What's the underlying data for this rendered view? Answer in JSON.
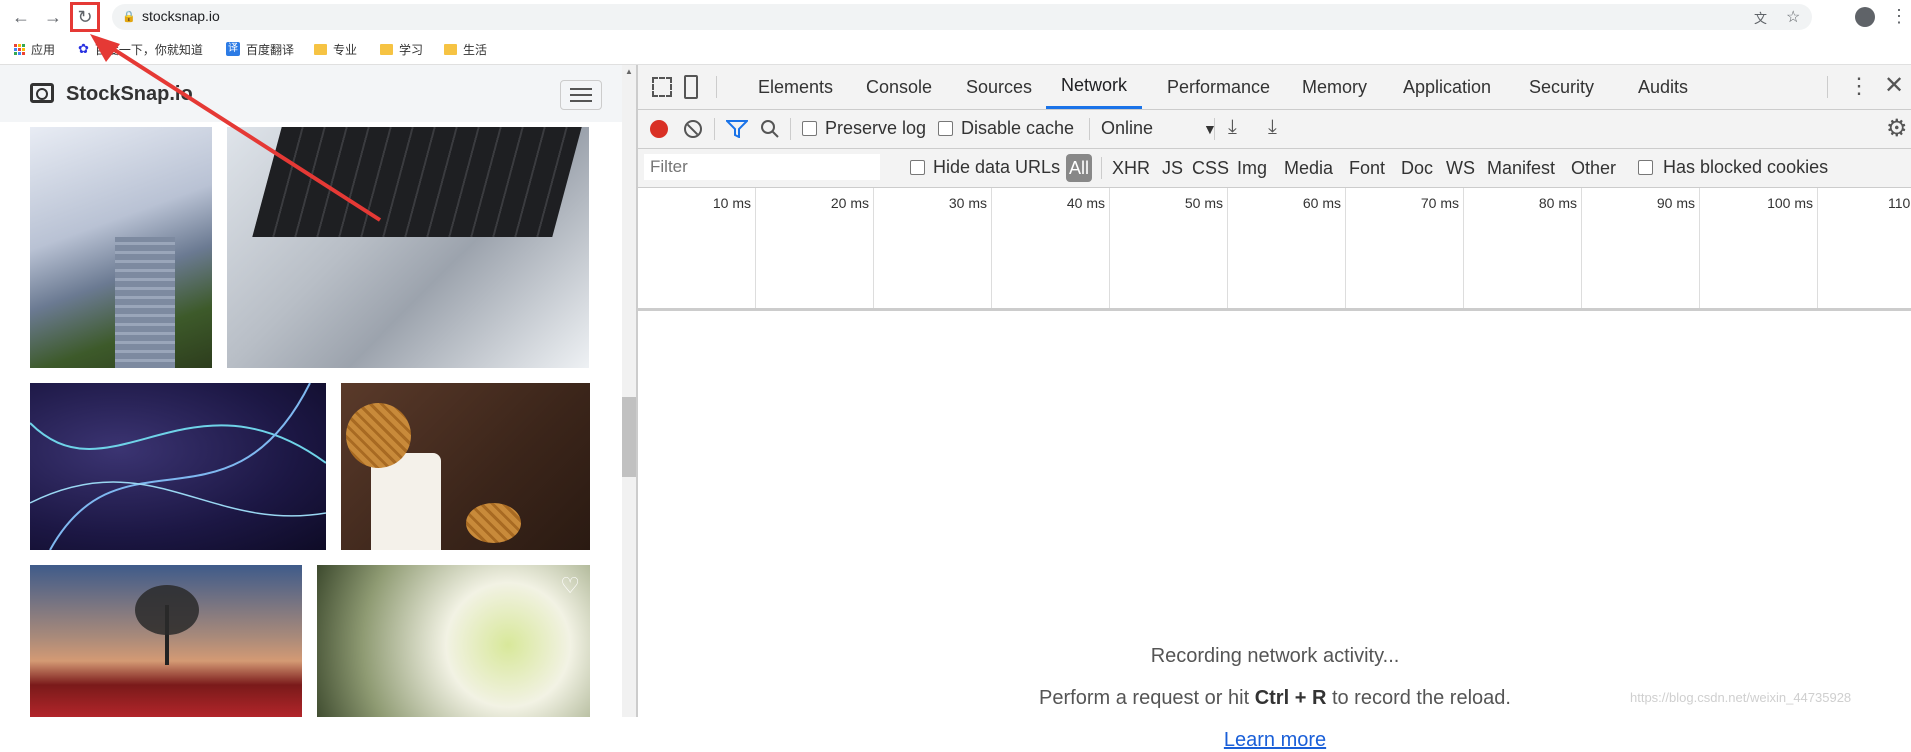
{
  "browser": {
    "url": "stocksnap.io",
    "bookmarks": [
      {
        "label": "应用",
        "icon": "apps-grid-icon"
      },
      {
        "label": "百度一下，你就知道",
        "icon": "baidu-paw-icon"
      },
      {
        "label": "百度翻译",
        "icon": "baidu-translate-icon"
      },
      {
        "label": "专业",
        "icon": "folder-icon"
      },
      {
        "label": "学习",
        "icon": "folder-icon"
      },
      {
        "label": "生活",
        "icon": "folder-icon"
      }
    ]
  },
  "site": {
    "brand": "StockSnap.io"
  },
  "devtools": {
    "tabs": [
      "Elements",
      "Console",
      "Sources",
      "Network",
      "Performance",
      "Memory",
      "Application",
      "Security",
      "Audits"
    ],
    "active_tab": "Network",
    "toolbar": {
      "preserve_log": "Preserve log",
      "disable_cache": "Disable cache",
      "throttle": "Online"
    },
    "filter": {
      "placeholder": "Filter",
      "hide_data_urls": "Hide data URLs",
      "types": [
        "All",
        "XHR",
        "JS",
        "CSS",
        "Img",
        "Media",
        "Font",
        "Doc",
        "WS",
        "Manifest",
        "Other"
      ],
      "has_blocked_cookies": "Has blocked cookies"
    },
    "timeline_ticks": [
      "10 ms",
      "20 ms",
      "30 ms",
      "40 ms",
      "50 ms",
      "60 ms",
      "70 ms",
      "80 ms",
      "90 ms",
      "100 ms",
      "110"
    ],
    "empty": {
      "line1": "Recording network activity...",
      "line2_pre": "Perform a request or hit ",
      "line2_keys": "Ctrl + R",
      "line2_post": " to record the reload.",
      "link": "Learn more"
    }
  },
  "watermark": "https://blog.csdn.net/weixin_44735928",
  "colors": {
    "accent": "#1a73e8",
    "record": "#d93025",
    "annotation": "#e53935"
  }
}
